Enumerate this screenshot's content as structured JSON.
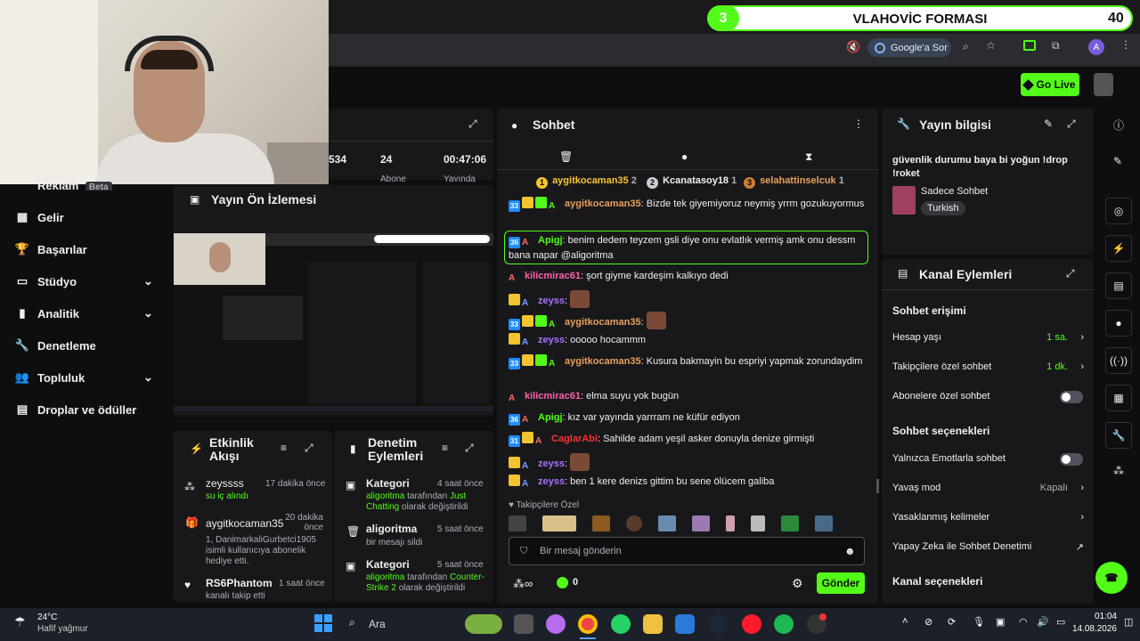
{
  "obs": {
    "number": "3",
    "title": "VLAHOVİC FORMASI",
    "count": "40"
  },
  "browser": {
    "google_ask": "Google'a Sor",
    "profile": "A"
  },
  "header": {
    "go_live": "Go Live"
  },
  "stats": {
    "followers_partial": "534",
    "subs_count": "24",
    "subs_label": "Abone",
    "uptime": "00:47:06",
    "uptime_label": "Yayında"
  },
  "sidebar": {
    "ads": "Reklam",
    "ads_badge": "Beta",
    "items": [
      {
        "label": "Gelir"
      },
      {
        "label": "Başarılar"
      },
      {
        "label": "Stüdyo"
      },
      {
        "label": "Analitik"
      },
      {
        "label": "Denetleme"
      },
      {
        "label": "Topluluk"
      },
      {
        "label": "Droplar ve ödüller"
      }
    ]
  },
  "preview": {
    "title": "Yayın Ön İzlemesi"
  },
  "activity": {
    "title": "Etkinlik Akışı",
    "items": [
      {
        "user": "zeyssss",
        "time": "17 dakika önce",
        "detail": "su iç alındı"
      },
      {
        "user": "aygitkocaman35",
        "time": "20 dakika önce",
        "detail": "1, DanimarkaliGurbetci1905 isimli kullanıcıya abonelik hediye etti."
      },
      {
        "user": "RS6Phantom",
        "time": "1 saat önce",
        "detail": "kanalı takip etti"
      }
    ]
  },
  "mod": {
    "title": "Denetim Eylemleri",
    "items": [
      {
        "label": "Kategori",
        "time": "4 saat önce",
        "who": "aligoritma",
        "text": "tarafından",
        "value": "Just Chatting",
        "tail": "olarak değiştirildi"
      },
      {
        "label": "aligoritma",
        "time": "5 saat önce",
        "text": "bir mesajı sildi"
      },
      {
        "label": "Kategori",
        "time": "5 saat önce",
        "who": "aligoritma",
        "text": "tarafından",
        "value": "Counter-Strike 2",
        "tail": "olarak değiştirildi"
      }
    ]
  },
  "chat": {
    "title": "Sohbet",
    "top": [
      {
        "rank": "1",
        "user": "aygitkocaman35",
        "count": "2"
      },
      {
        "rank": "2",
        "user": "Kcanatasoy18",
        "count": "1"
      },
      {
        "rank": "3",
        "user": "selahattinselcuk",
        "count": "1"
      }
    ],
    "messages": [
      {
        "sub": "33",
        "user": "aygitkocaman35",
        "text": "Bizde tek giyemiyoruz neymiş yrrm gozukuyormus"
      },
      {
        "sub": "36",
        "user": "Apigj",
        "text": "benim dedem teyzem gsli diye onu evlatlık vermiş amk onu dessm bana napar @aligoritma"
      },
      {
        "user": "kilicmirac61",
        "text": "şort giyme kardeşim kalkıyo dedi"
      },
      {
        "user": "zeyss",
        "text": ""
      },
      {
        "sub": "33",
        "user": "aygitkocaman35",
        "text": ""
      },
      {
        "user": "zeyss",
        "text": "ooooo hocammm"
      },
      {
        "sub": "33",
        "user": "aygitkocaman35",
        "text": "Kusura bakmayin bu espriyi yapmak zorundaydim"
      },
      {
        "user": "kilicmirac61",
        "text": "elma suyu yok bugün"
      },
      {
        "sub": "36",
        "user": "Apigj",
        "text": "kız var yayında yarrram ne küfür ediyon"
      },
      {
        "sub": "31",
        "user": "CaglarAbi",
        "text": "Sahilde adam yeşil asker donuyla denize girmişti"
      },
      {
        "user": "zeyss",
        "text": ""
      },
      {
        "user": "zeyss",
        "text": "ben 1 kere denizs gittim bu sene ölücem galiba"
      }
    ],
    "followers_only": "Takipçilere Özel",
    "placeholder": "Bir mesaj gönderin",
    "points": "0",
    "send": "Gönder"
  },
  "stream_info": {
    "title": "Yayın bilgisi",
    "stream_title": "güvenlik durumu baya bi yoğun !drop !roket",
    "category": "Sadece Sohbet",
    "tag": "Turkish"
  },
  "channel_actions": {
    "title": "Kanal Eylemleri",
    "chat_access": "Sohbet erişimi",
    "rows1": [
      {
        "label": "Hesap yaşı",
        "value": "1 sa."
      },
      {
        "label": "Takipçilere özel sohbet",
        "value": "1 dk."
      },
      {
        "label": "Abonelere özel sohbet",
        "value": ""
      }
    ],
    "chat_options": "Sohbet seçenekleri",
    "rows2": [
      {
        "label": "Yalnızca Emotlarla sohbet",
        "value": ""
      },
      {
        "label": "Yavaş mod",
        "value": "Kapalı"
      },
      {
        "label": "Yasaklanmış kelimeler",
        "value": ""
      },
      {
        "label": "Yapay Zeka ile Sohbet Denetimi",
        "value": ""
      }
    ],
    "channel_options": "Kanal seçenekleri"
  },
  "taskbar": {
    "temp": "24°C",
    "weather": "Hafif yağmur",
    "search": "Ara",
    "time": "01:04",
    "date": "14.08.2026"
  },
  "colors": {
    "accent": "#53fc18",
    "panel": "#18181b",
    "bg": "#0e0e10"
  }
}
